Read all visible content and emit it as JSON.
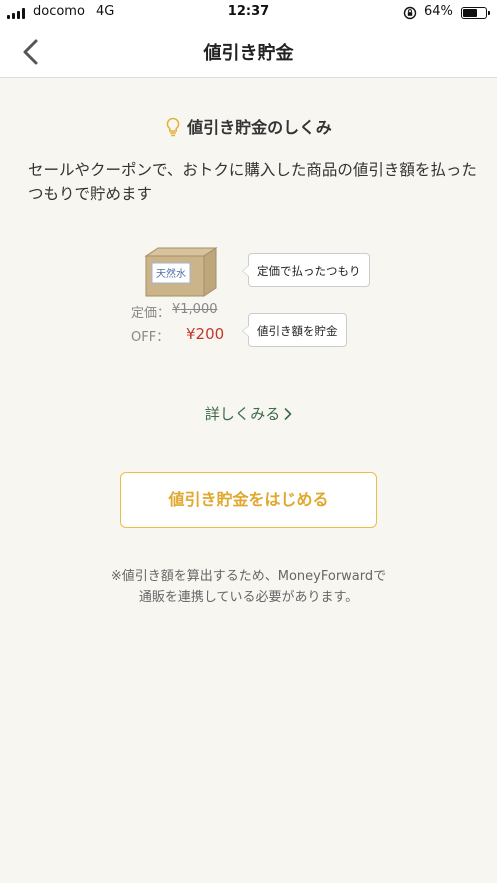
{
  "status_bar": {
    "carrier": "docomo",
    "network": "4G",
    "time": "12:37",
    "battery": "64%",
    "battery_level": 0.64
  },
  "nav": {
    "title": "値引き貯金",
    "back_icon": "chevron-left-icon"
  },
  "section": {
    "icon": "lightbulb-icon",
    "heading": "値引き貯金のしくみ",
    "description": "セールやクーポンで、おトクに購入した商品の値引き額を払ったつもりで貯めます"
  },
  "illustration": {
    "box_label": "天然水",
    "list_price_label": "定価：",
    "list_price_value": "¥1,000",
    "off_label": "OFF：",
    "off_value": "¥200",
    "bubble_1": "定価で払ったつもり",
    "bubble_2": "値引き額を貯金"
  },
  "details_link": "詳しくみる",
  "start_button": "値引き貯金をはじめる",
  "note_line_1": "※値引き額を算出するため、MoneyForwardで",
  "note_line_2": "通販を連携している必要があります。",
  "colors": {
    "background": "#f8f6f1",
    "accent_gold": "#e0a82d",
    "link_green": "#3b6b48",
    "price_red": "#c0392b"
  }
}
